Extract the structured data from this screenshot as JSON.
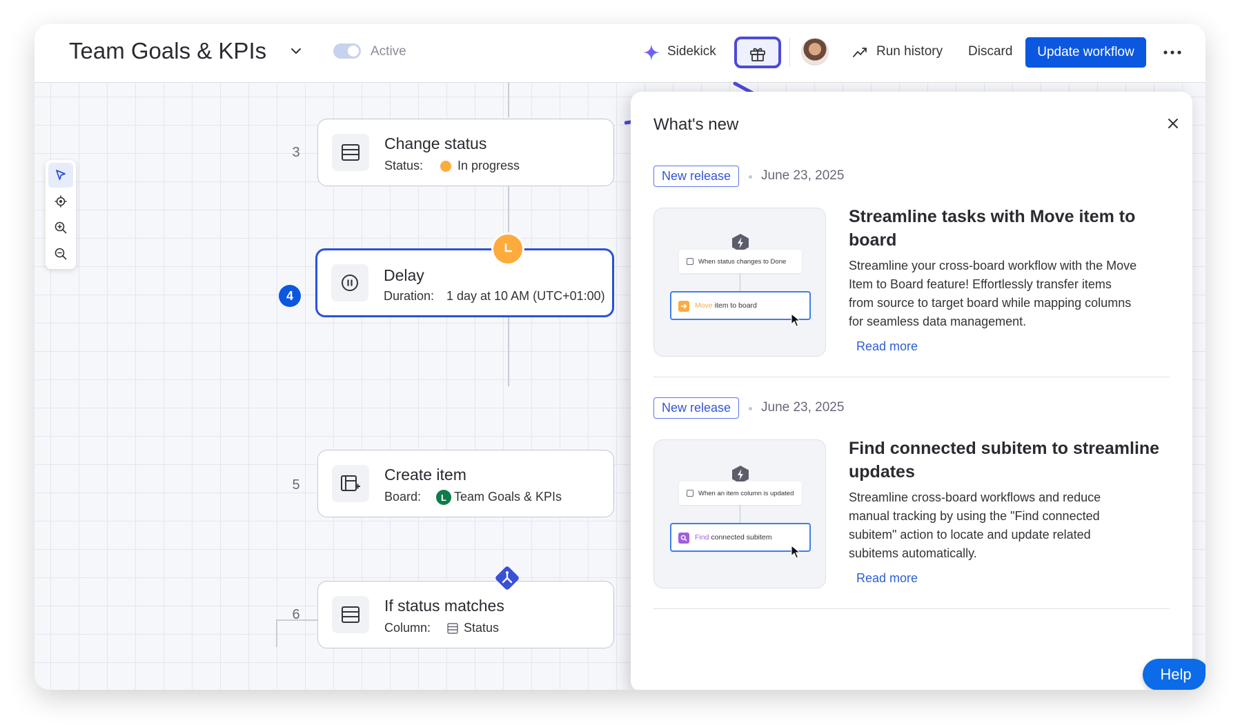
{
  "header": {
    "title": "Team Goals & KPIs",
    "status_label": "Active",
    "sidekick_label": "Sidekick",
    "run_history_label": "Run history",
    "discard_label": "Discard",
    "update_label": "Update workflow"
  },
  "steps": [
    {
      "number": "3",
      "title": "Change status",
      "key": "Status:",
      "value": "In progress",
      "icon": "table-icon",
      "value_color": "#fdab3d"
    },
    {
      "number": "4",
      "title": "Delay",
      "key": "Duration:",
      "value": "1 day at 10 AM (UTC+01:00)",
      "icon": "pause-icon",
      "active": true
    },
    {
      "number": "5",
      "title": "Create item",
      "key": "Board:",
      "value": "Team Goals & KPIs",
      "icon": "create-item-icon",
      "badge_letter": "L",
      "badge_color": "#0f7b4a"
    },
    {
      "number": "6",
      "title": "If status matches",
      "key": "Column:",
      "value": "Status",
      "icon": "table-icon"
    }
  ],
  "whats_new": {
    "title": "What's new",
    "items": [
      {
        "tag": "New release",
        "date": "June 23, 2025",
        "title": "Streamline tasks with Move item to board",
        "body": "Streamline your cross-board workflow with the Move Item to Board feature! Effortlessly transfer items from source to target board while mapping columns for seamless data management.",
        "read_more": "Read more",
        "preview_trigger": "When status changes to Done",
        "preview_action_accent": "Move",
        "preview_action_rest": " item to board",
        "accent_color": "#fdab3d"
      },
      {
        "tag": "New release",
        "date": "June 23, 2025",
        "title": "Find connected subitem to streamline updates",
        "body": "Streamline cross-board workflows and reduce manual tracking by using the \"Find connected subitem\" action to locate and update related subitems automatically.",
        "read_more": "Read more",
        "preview_trigger": "When an item column is updated",
        "preview_action_accent": "Find",
        "preview_action_rest": " connected subitem",
        "accent_color": "#a25ddc"
      }
    ]
  },
  "help_label": "Help",
  "colors": {
    "primary": "#0b57e0",
    "highlight": "#4c4ad8",
    "delay_badge": "#fdab3d",
    "branch_badge": "#3a50d9"
  }
}
